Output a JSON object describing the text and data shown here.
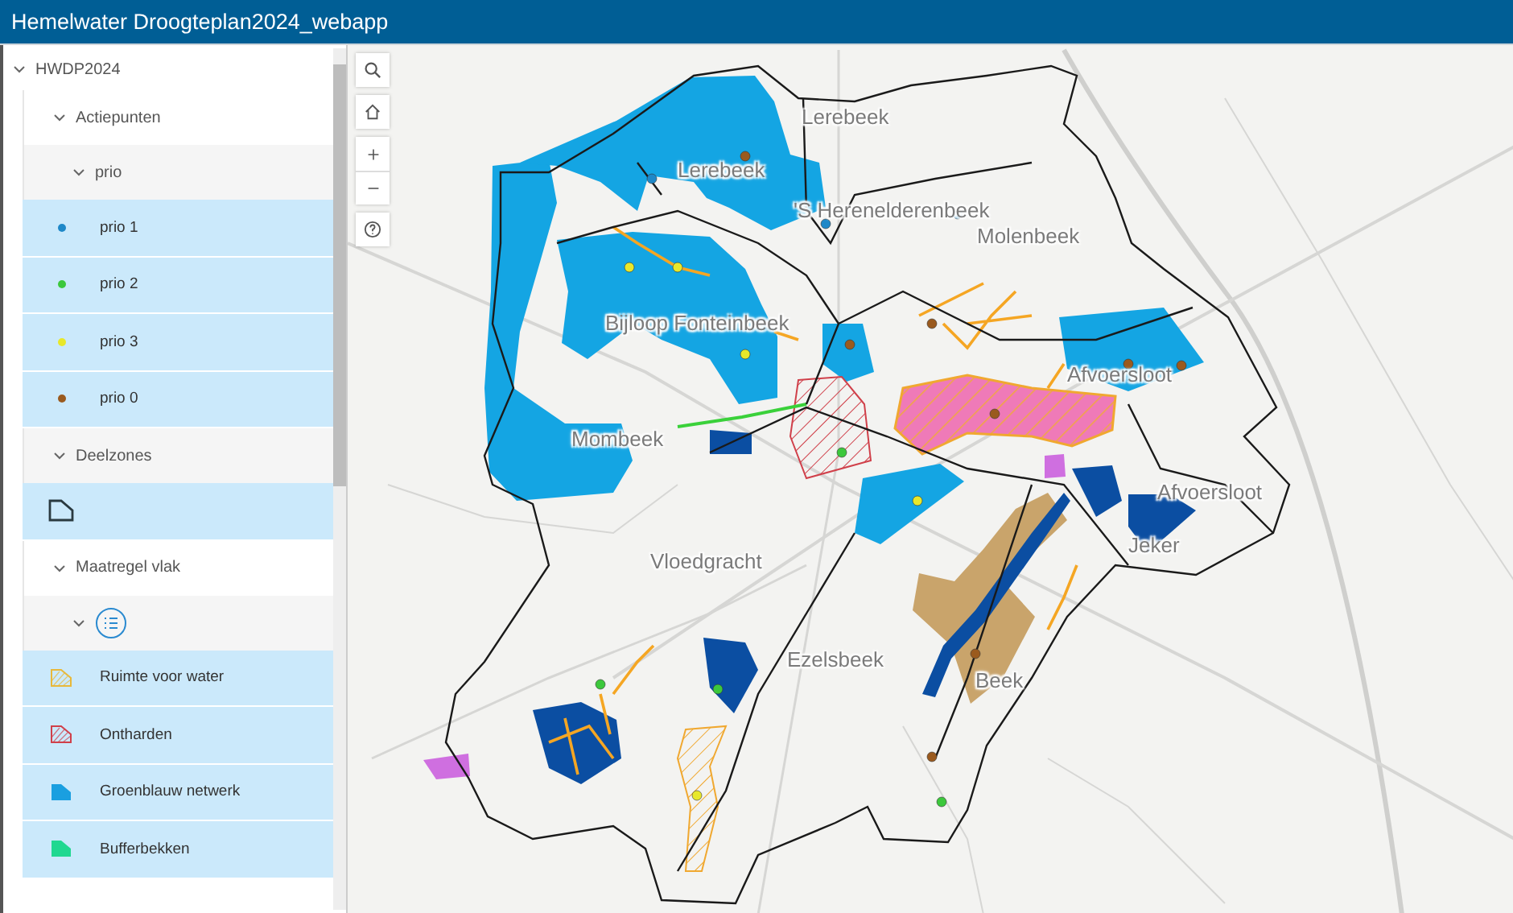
{
  "header": {
    "title": "Hemelwater Droogteplan2024_webapp"
  },
  "toc": [
    {
      "label": "HWDP2024",
      "expanded": true,
      "children": [
        {
          "label": "Actiepunten",
          "expanded": true,
          "children": [
            {
              "label": "prio",
              "expanded": true,
              "legend": [
                {
                  "kind": "dot",
                  "label": "prio 1",
                  "color": "#1e88c8"
                },
                {
                  "kind": "dot",
                  "label": "prio 2",
                  "color": "#3cc83c"
                },
                {
                  "kind": "dot",
                  "label": "prio 3",
                  "color": "#e8e82a"
                },
                {
                  "kind": "dot",
                  "label": "prio 0",
                  "color": "#9a5a1e"
                }
              ]
            }
          ]
        },
        {
          "label": "Deelzones",
          "expanded": true,
          "legend": [
            {
              "kind": "outline",
              "color": "#2a3a40"
            }
          ]
        },
        {
          "label": "Maatregel vlak",
          "expanded": true,
          "children": [
            {
              "kind": "list",
              "expanded": true,
              "legend": [
                {
                  "kind": "hatch",
                  "label": "Ruimte voor water",
                  "color": "#e8b83a"
                },
                {
                  "kind": "hatch",
                  "label": "Ontharden",
                  "color": "#d0404a"
                },
                {
                  "kind": "solid",
                  "label": "Groenblauw netwerk",
                  "color": "#1a9fe0"
                },
                {
                  "kind": "solid",
                  "label": "Bufferbekken",
                  "color": "#20d890"
                }
              ]
            }
          ]
        }
      ]
    }
  ],
  "map": {
    "zone_labels": [
      "Lerebeek",
      "Lerebeek",
      "'S Herenelderenbeek",
      "Molenbeek",
      "Bijloop Fonteinbeek",
      "Afvoersloot",
      "Mombeek",
      "Afvoersloot",
      "Jeker",
      "Vloedgracht",
      "Ezelsbeek",
      "Beek"
    ]
  }
}
